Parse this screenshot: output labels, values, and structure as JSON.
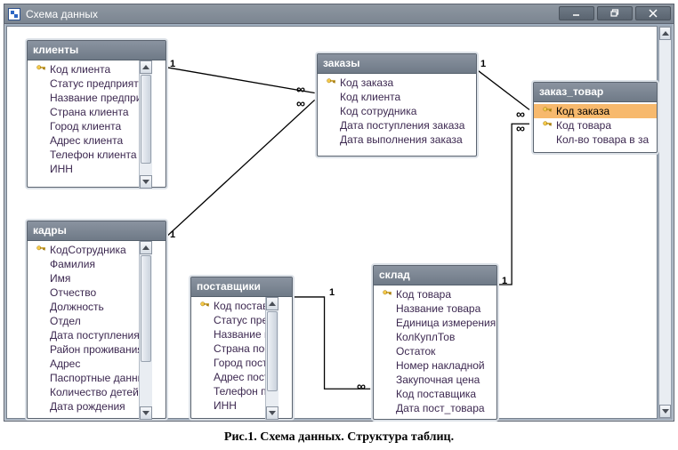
{
  "window": {
    "title": "Схема данных"
  },
  "tables": {
    "clients": {
      "title": "клиенты",
      "fields": [
        {
          "key": true,
          "label": "Код клиента"
        },
        {
          "key": false,
          "label": "Статус предприяти"
        },
        {
          "key": false,
          "label": "Название предпри"
        },
        {
          "key": false,
          "label": "Страна клиента"
        },
        {
          "key": false,
          "label": "Город клиента"
        },
        {
          "key": false,
          "label": "Адрес клиента"
        },
        {
          "key": false,
          "label": "Телефон клиента"
        },
        {
          "key": false,
          "label": "ИНН"
        }
      ]
    },
    "staff": {
      "title": "кадры",
      "fields": [
        {
          "key": true,
          "label": "КодСотрудника"
        },
        {
          "key": false,
          "label": "Фамилия"
        },
        {
          "key": false,
          "label": "Имя"
        },
        {
          "key": false,
          "label": "Отчество"
        },
        {
          "key": false,
          "label": "Должность"
        },
        {
          "key": false,
          "label": "Отдел"
        },
        {
          "key": false,
          "label": "Дата поступления"
        },
        {
          "key": false,
          "label": "Район проживания"
        },
        {
          "key": false,
          "label": "Адрес"
        },
        {
          "key": false,
          "label": "Паспортные данные"
        },
        {
          "key": false,
          "label": "Количество детей"
        },
        {
          "key": false,
          "label": "Дата рождения"
        }
      ]
    },
    "orders": {
      "title": "заказы",
      "fields": [
        {
          "key": true,
          "label": "Код заказа"
        },
        {
          "key": false,
          "label": "Код клиента"
        },
        {
          "key": false,
          "label": "Код сотрудника"
        },
        {
          "key": false,
          "label": "Дата поступления заказа"
        },
        {
          "key": false,
          "label": "Дата выполнения заказа"
        }
      ]
    },
    "order_goods": {
      "title": "заказ_товар",
      "fields": [
        {
          "key": true,
          "label": "Код заказа",
          "selected": true
        },
        {
          "key": true,
          "label": "Код товара"
        },
        {
          "key": false,
          "label": "Кол-во товара в за"
        }
      ]
    },
    "suppliers": {
      "title": "поставщики",
      "fields": [
        {
          "key": true,
          "label": "Код поставщ"
        },
        {
          "key": false,
          "label": "Статус предп"
        },
        {
          "key": false,
          "label": "Название пр"
        },
        {
          "key": false,
          "label": "Страна поста"
        },
        {
          "key": false,
          "label": "Город постав"
        },
        {
          "key": false,
          "label": "Адрес постав"
        },
        {
          "key": false,
          "label": "Телефон пос"
        },
        {
          "key": false,
          "label": "ИНН"
        }
      ]
    },
    "stock": {
      "title": "склад",
      "fields": [
        {
          "key": true,
          "label": "Код товара"
        },
        {
          "key": false,
          "label": "Название товара"
        },
        {
          "key": false,
          "label": "Единица измерения"
        },
        {
          "key": false,
          "label": "КолКуплТов"
        },
        {
          "key": false,
          "label": "Остаток"
        },
        {
          "key": false,
          "label": "Номер накладной"
        },
        {
          "key": false,
          "label": "Закупочная цена"
        },
        {
          "key": false,
          "label": "Код поставщика"
        },
        {
          "key": false,
          "label": "Дата пост_товара"
        }
      ]
    }
  },
  "relations": {
    "one": "1",
    "many": "∞"
  },
  "caption": "Рис.1. Схема данных. Структура таблиц."
}
